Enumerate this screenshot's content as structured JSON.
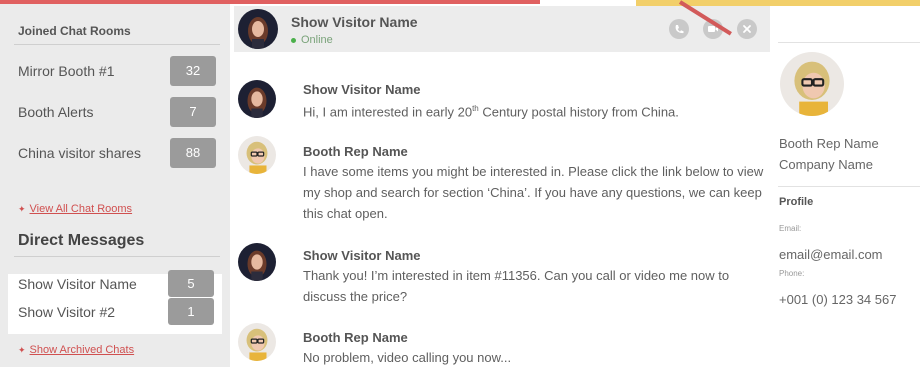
{
  "sidebar": {
    "rooms_title": "Joined Chat Rooms",
    "rooms": [
      {
        "label": "Mirror Booth #1",
        "count": "32"
      },
      {
        "label": "Booth Alerts",
        "count": "7"
      },
      {
        "label": "China visitor shares",
        "count": "88"
      }
    ],
    "view_all_link": "View All Chat Rooms",
    "dm_title": "Direct Messages",
    "direct_messages": [
      {
        "label": "Show Visitor Name",
        "count": "5"
      },
      {
        "label": "Show Visitor  #2",
        "count": "1"
      }
    ],
    "archived_link": "Show Archived Chats",
    "plus_glyph": "✦"
  },
  "chat_header": {
    "name": "Show Visitor Name",
    "status": "Online",
    "status_color": "#4bb04b",
    "buttons": [
      "phone-icon",
      "video-icon",
      "close-icon"
    ]
  },
  "messages": [
    {
      "sender": "Show Visitor Name",
      "text_a": "Hi, I am interested in early 20",
      "sup": "th",
      "text_b": " Century postal history from China.",
      "avatar": "visitor"
    },
    {
      "sender": "Booth Rep Name",
      "text": "I have some items you might be interested in. Please click the link below to view my shop and search for section ‘China’. If you have any questions, we can keep this chat open.",
      "avatar": "rep"
    },
    {
      "sender": "Show Visitor Name",
      "text": "Thank you! I’m interested in item #11356. Can you call or video me now to discuss the price?",
      "avatar": "visitor"
    },
    {
      "sender": "Booth Rep Name",
      "text": "No problem, video calling you now...",
      "avatar": "rep"
    }
  ],
  "profile": {
    "name": "Booth Rep Name",
    "company": "Company Name",
    "section_title": "Profile",
    "email_label": "Email:",
    "email": "email@email.com",
    "phone_label": "Phone:",
    "phone": "+001 (0) 123 34 567"
  },
  "colors": {
    "accent_red": "#e06060",
    "accent_yellow": "#f2cf6a",
    "badge": "#9b9b9b"
  }
}
